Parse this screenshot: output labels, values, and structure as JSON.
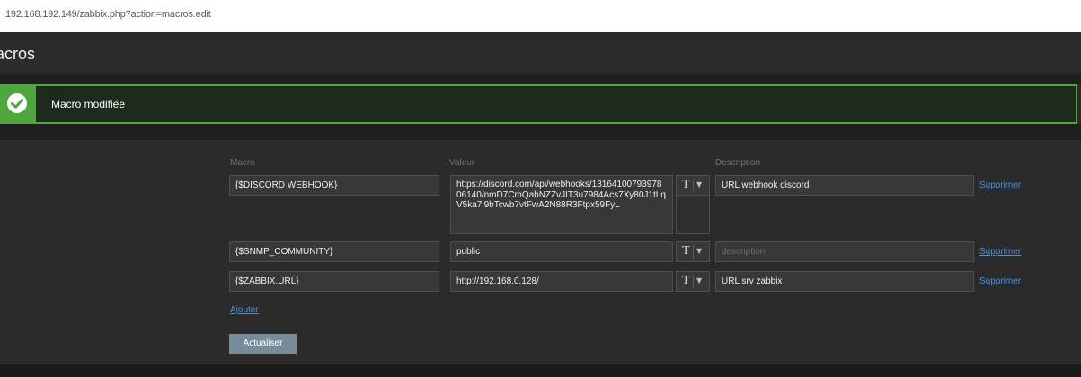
{
  "browser": {
    "url": "192.168.192.149/zabbix.php?action=macros.edit"
  },
  "page": {
    "title": "acros"
  },
  "message": {
    "text": "Macro modifiée",
    "status_color": "#4ea63c"
  },
  "table": {
    "headers": {
      "macro": "Macro",
      "value": "Valeur",
      "description": "Description"
    },
    "rows": [
      {
        "macro": "{$DISCORD WEBHOOK}",
        "value": "https://discord.com/api/webhooks/1316410079397806140/nmD7CmQabNZZvJIT3u7984Acs7Xy80J1tLqV5ka7l9bTcwb7vtFwA2N88R3Ftpx59FyL",
        "type_icon": "T",
        "description": "URL webhook discord",
        "description_placeholder": "",
        "remove": "Supprimer"
      },
      {
        "macro": "{$SNMP_COMMUNITY}",
        "value": "public",
        "type_icon": "T",
        "description": "",
        "description_placeholder": "description",
        "remove": "Supprimer"
      },
      {
        "macro": "{$ZABBIX.URL}",
        "value": "http://192.168.0.128/",
        "type_icon": "T",
        "description": "URL srv zabbix",
        "description_placeholder": "",
        "remove": "Supprimer"
      }
    ],
    "add_label": "Ajouter"
  },
  "actions": {
    "update_label": "Actualiser"
  },
  "colors": {
    "accent_link": "#4f8fd6",
    "button": "#768d99",
    "success": "#4ea63c"
  }
}
